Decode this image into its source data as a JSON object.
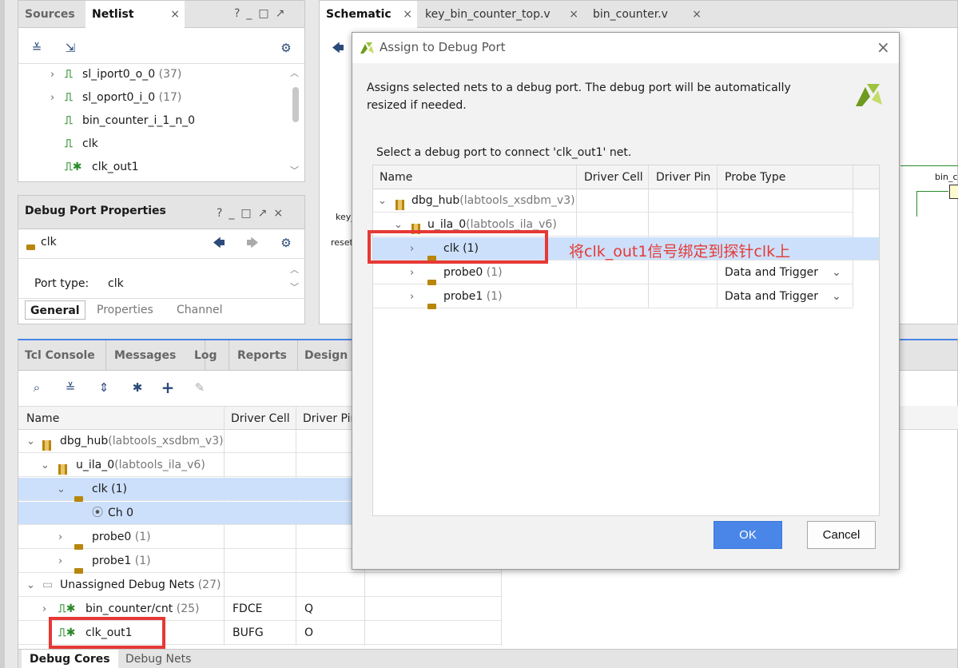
{
  "sources_panel": {
    "tabs": [
      {
        "label": "Sources"
      },
      {
        "label": "Netlist"
      }
    ],
    "tab_close": "×",
    "items": [
      {
        "label": "sl_iport0_o_0",
        "count": "(37)"
      },
      {
        "label": "sl_oport0_i_0",
        "count": "(17)"
      },
      {
        "label": "bin_counter_i_1_n_0",
        "count": ""
      },
      {
        "label": "clk",
        "count": ""
      },
      {
        "label": "clk_out1",
        "count": ""
      }
    ]
  },
  "debug_port_props": {
    "title": "Debug Port Properties",
    "selected": "clk",
    "port_type_label": "Port type:",
    "port_type_value": "clk",
    "tabs": [
      {
        "label": "General"
      },
      {
        "label": "Properties"
      },
      {
        "label": "Channel"
      }
    ]
  },
  "editor_tabs": [
    {
      "label": "Schematic"
    },
    {
      "label": "key_bin_counter_top.v"
    },
    {
      "label": "bin_counter.v"
    }
  ],
  "schematic": {
    "labels": [
      "key_",
      "reset",
      "bin_c"
    ]
  },
  "debug_window": {
    "tabs": [
      {
        "label": "Tcl Console"
      },
      {
        "label": "Messages"
      },
      {
        "label": "Log"
      },
      {
        "label": "Reports"
      },
      {
        "label": "Design R"
      }
    ],
    "columns": [
      "Name",
      "Driver Cell",
      "Driver Pin"
    ],
    "rows": [
      {
        "name": "dbg_hub",
        "suffix": "(labtools_xsdbm_v3)",
        "cell": "",
        "pin": ""
      },
      {
        "name": "u_ila_0",
        "suffix": "(labtools_ila_v6)",
        "cell": "",
        "pin": ""
      },
      {
        "name": "clk",
        "suffix": "(1)",
        "cell": "",
        "pin": ""
      },
      {
        "name": "Ch 0",
        "suffix": "",
        "cell": "",
        "pin": ""
      },
      {
        "name": "probe0",
        "suffix": "(1)",
        "cell": "",
        "pin": ""
      },
      {
        "name": "probe1",
        "suffix": "(1)",
        "cell": "",
        "pin": ""
      },
      {
        "name": "Unassigned Debug Nets",
        "suffix": "(27)",
        "cell": "",
        "pin": ""
      },
      {
        "name": "bin_counter/cnt",
        "suffix": "(25)",
        "cell": "FDCE",
        "pin": "Q"
      },
      {
        "name": "clk_out1",
        "suffix": "",
        "cell": "BUFG",
        "pin": "O"
      }
    ],
    "bottom_tabs": [
      {
        "label": "Debug Cores"
      },
      {
        "label": "Debug Nets"
      }
    ]
  },
  "dialog": {
    "title": "Assign to Debug Port",
    "close": "×",
    "description": "Assigns selected nets to a debug port. The debug port will be automatically resized if needed.",
    "prompt": "Select a debug port to connect 'clk_out1' net.",
    "columns": [
      "Name",
      "Driver Cell",
      "Driver Pin",
      "Probe Type"
    ],
    "rows": [
      {
        "name": "dbg_hub",
        "suffix": "(labtools_xsdbm_v3)",
        "probe": ""
      },
      {
        "name": "u_ila_0",
        "suffix": "(labtools_ila_v6)",
        "probe": ""
      },
      {
        "name": "clk",
        "suffix": "(1)",
        "probe": ""
      },
      {
        "name": "probe0",
        "suffix": "(1)",
        "probe": "Data and Trigger"
      },
      {
        "name": "probe1",
        "suffix": "(1)",
        "probe": "Data and Trigger"
      }
    ],
    "ok": "OK",
    "cancel": "Cancel"
  },
  "annotation": "将clk_out1信号绑定到探针clk上",
  "colors": {
    "accent": "#4a86e8",
    "selection": "#cce0fb",
    "annotation": "#e53935"
  }
}
